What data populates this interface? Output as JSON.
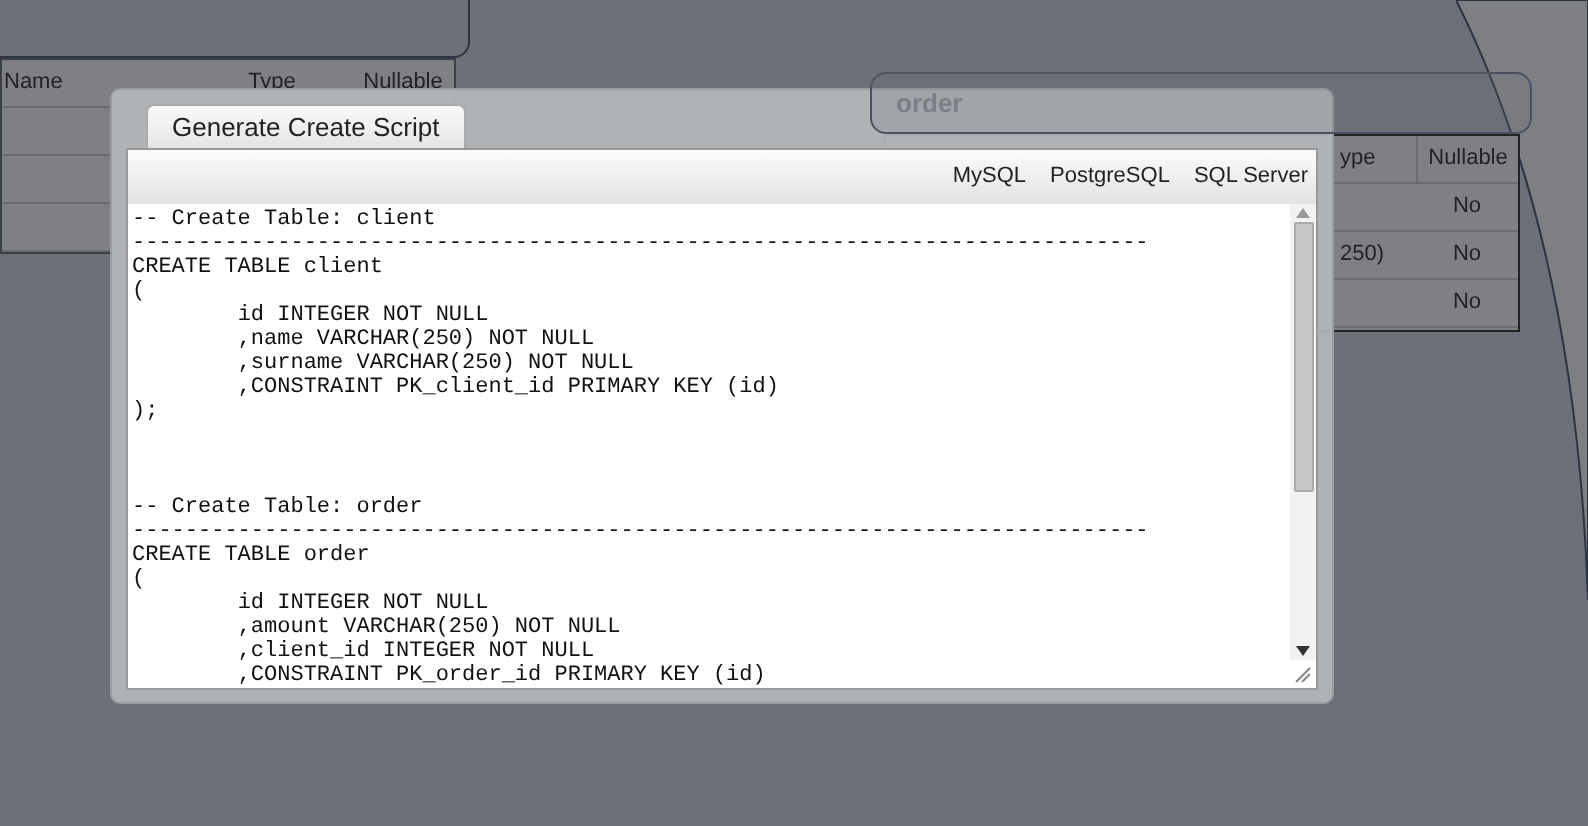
{
  "left_table": {
    "columns": [
      "Name",
      "Type",
      "Nullable"
    ]
  },
  "right_table": {
    "title": "order",
    "columns": [
      "ype",
      "Nullable"
    ],
    "rows": [
      {
        "nullable": "No"
      },
      {
        "type": "250)",
        "nullable": "No"
      },
      {
        "nullable": "No"
      }
    ]
  },
  "dialog": {
    "tabs": [
      {
        "label": "Generate Create Script",
        "selected": true
      }
    ],
    "dialects": [
      "MySQL",
      "PostgreSQL",
      "SQL Server"
    ],
    "script": "-- Create Table: client\n-----------------------------------------------------------------------------\nCREATE TABLE client\n(\n\tid INTEGER NOT NULL\n\t,name VARCHAR(250) NOT NULL\n\t,surname VARCHAR(250) NOT NULL\n\t,CONSTRAINT PK_client_id PRIMARY KEY (id)\n);\n\n\n\n-- Create Table: order\n-----------------------------------------------------------------------------\nCREATE TABLE order\n(\n\tid INTEGER NOT NULL\n\t,amount VARCHAR(250) NOT NULL\n\t,client_id INTEGER NOT NULL\n\t,CONSTRAINT PK_order_id PRIMARY KEY (id)"
  }
}
